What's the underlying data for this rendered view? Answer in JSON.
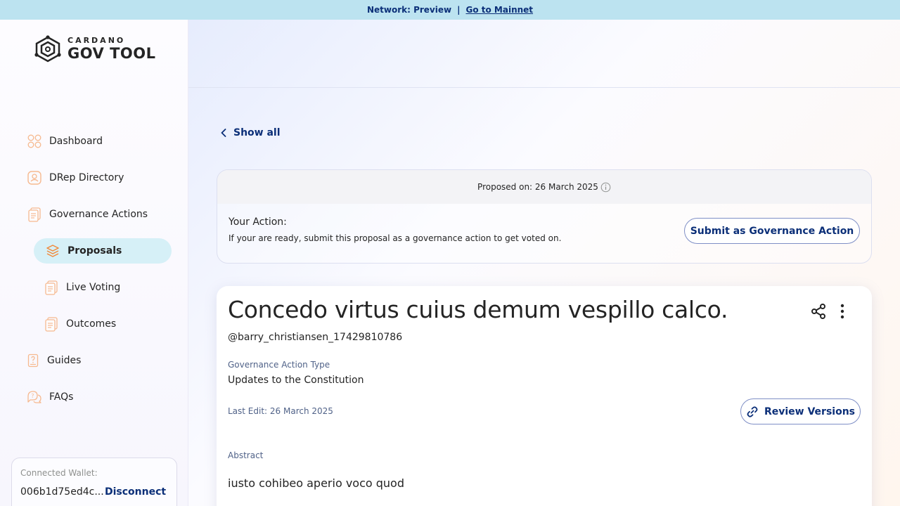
{
  "banner": {
    "network_text": "Network: Preview",
    "separator": "|",
    "link_text": "Go to Mainnet"
  },
  "logo": {
    "line1": "CARDANO",
    "line2": "GOV TOOL"
  },
  "sidebar": {
    "items": [
      {
        "label": "Dashboard",
        "icon": "dashboard-icon"
      },
      {
        "label": "DRep Directory",
        "icon": "drep-directory-icon"
      },
      {
        "label": "Governance Actions",
        "icon": "governance-actions-icon"
      },
      {
        "label": "Proposals",
        "icon": "proposals-icon",
        "active": true
      },
      {
        "label": "Live Voting",
        "icon": "live-voting-icon"
      },
      {
        "label": "Outcomes",
        "icon": "outcomes-icon"
      },
      {
        "label": "Guides",
        "icon": "guides-icon"
      },
      {
        "label": "FAQs",
        "icon": "faqs-icon"
      }
    ]
  },
  "wallet": {
    "label": "Connected Wallet:",
    "address": "006b1d75ed4c...",
    "disconnect_label": "Disconnect"
  },
  "main": {
    "show_all_label": "Show all",
    "action_card": {
      "proposed_on": "Proposed on: 26 March 2025",
      "your_action_title": "Your Action:",
      "your_action_subtitle": "If your are ready, submit this proposal as a governance action to get voted on.",
      "submit_button": "Submit as Governance Action"
    },
    "proposal": {
      "title": "Concedo virtus cuius demum vespillo calco.",
      "author": "@barry_christiansen_17429810786",
      "type_label": "Governance Action Type",
      "type_value": "Updates to the Constitution",
      "last_edit": "Last Edit: 26 March 2025",
      "review_button": "Review Versions",
      "abstract_label": "Abstract",
      "abstract_value": "iusto cohibeo aperio voco quod"
    }
  },
  "colors": {
    "accent": "#0b2f78",
    "banner_bg": "#bce3f0",
    "active_nav_bg": "#d6f0f7",
    "icon_orange": "#f6a16a"
  }
}
